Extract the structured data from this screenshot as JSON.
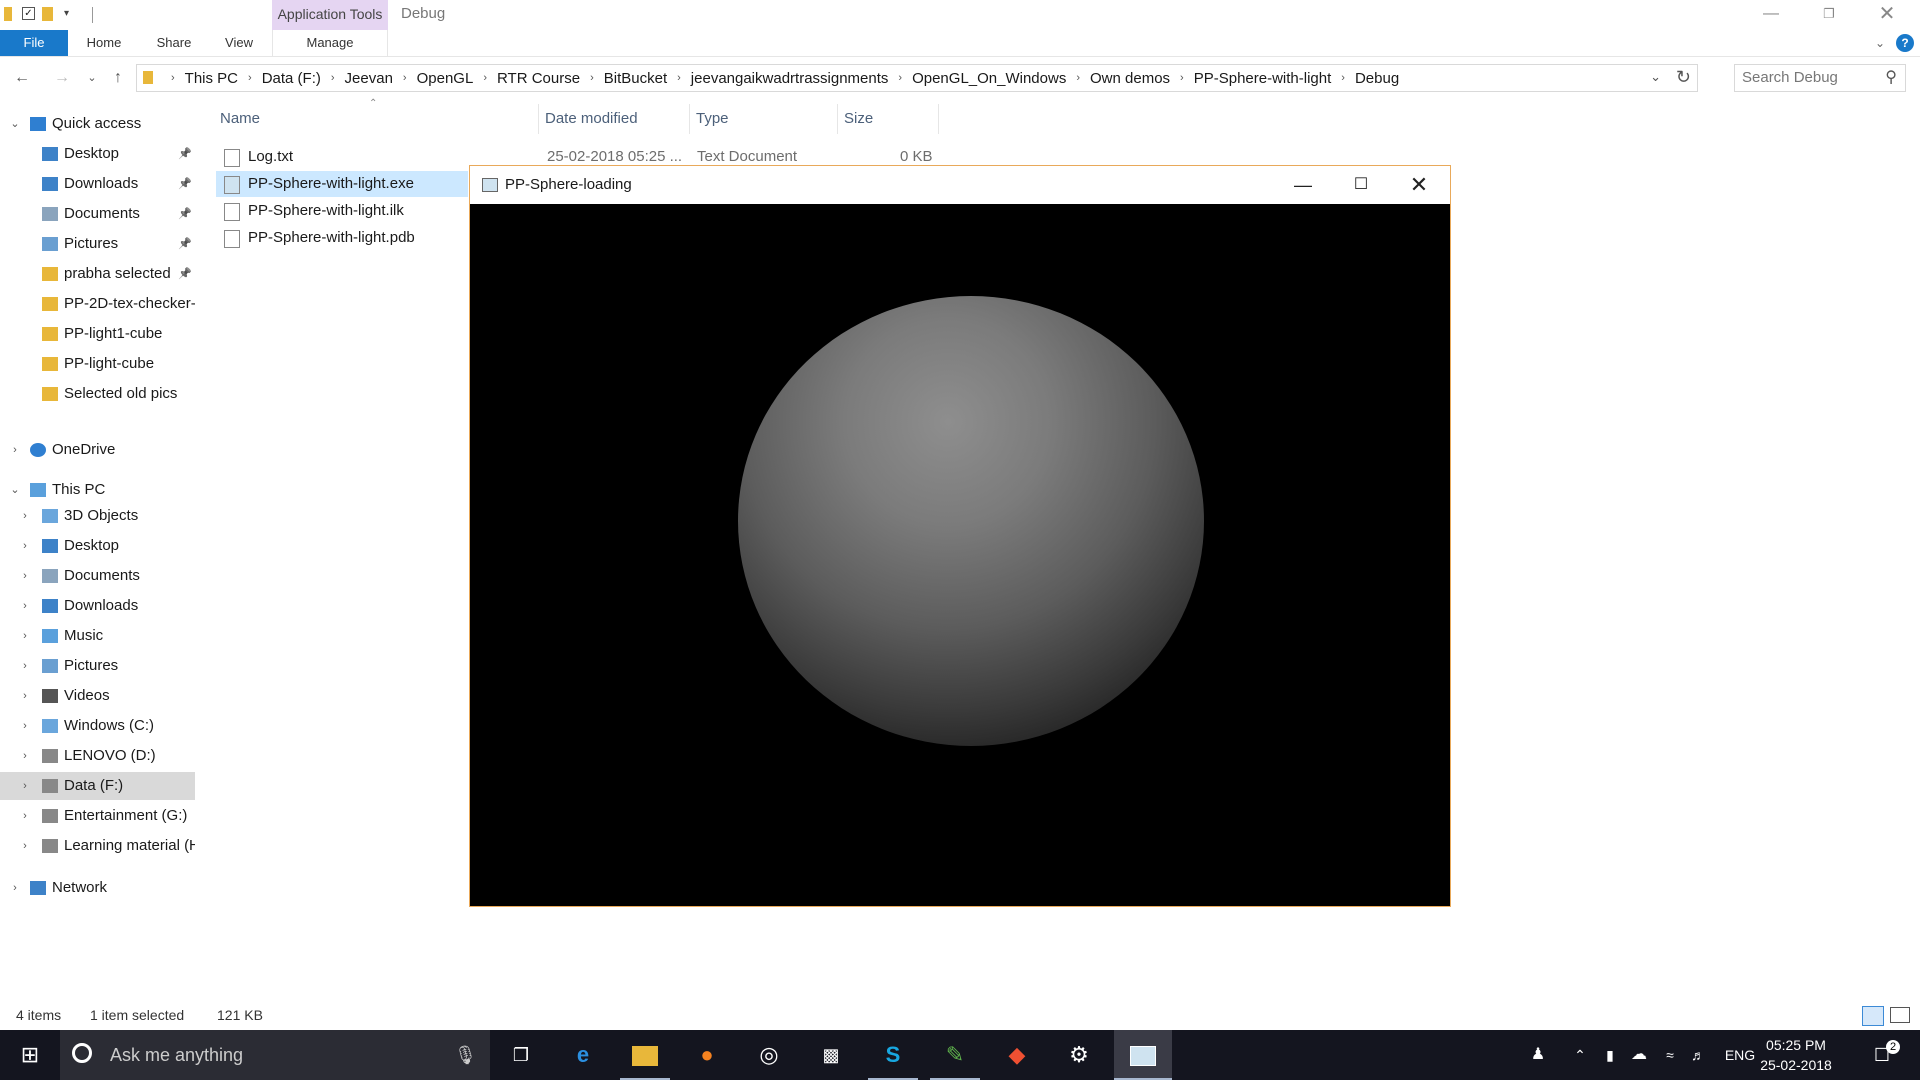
{
  "explorer": {
    "context_tab": "Application Tools",
    "window_title": "Debug",
    "ribbon_tabs": {
      "file": "File",
      "home": "Home",
      "share": "Share",
      "view": "View",
      "manage": "Manage"
    },
    "breadcrumbs": [
      "This PC",
      "Data (F:)",
      "Jeevan",
      "OpenGL",
      "RTR Course",
      "BitBucket",
      "jeevangaikwadrtrassignments",
      "OpenGL_On_Windows",
      "Own demos",
      "PP-Sphere-with-light",
      "Debug"
    ],
    "search_placeholder": "Search Debug",
    "nav": {
      "quick_access": "Quick access",
      "qa_items": [
        "Desktop",
        "Downloads",
        "Documents",
        "Pictures",
        "prabha selected",
        "PP-2D-tex-checker-",
        "PP-light1-cube",
        "PP-light-cube",
        "Selected old pics"
      ],
      "onedrive": "OneDrive",
      "this_pc": "This PC",
      "pc_items": [
        "3D Objects",
        "Desktop",
        "Documents",
        "Downloads",
        "Music",
        "Pictures",
        "Videos",
        "Windows (C:)",
        "LENOVO (D:)",
        "Data (F:)",
        "Entertainment (G:)",
        "Learning material (H"
      ],
      "network": "Network"
    },
    "columns": {
      "name": "Name",
      "date": "Date modified",
      "type": "Type",
      "size": "Size"
    },
    "files": [
      {
        "name": "Log.txt",
        "date": "25-02-2018 05:25 ...",
        "type": "Text Document",
        "size": "0 KB"
      },
      {
        "name": "PP-Sphere-with-light.exe",
        "date": "",
        "type": "",
        "size": ""
      },
      {
        "name": "PP-Sphere-with-light.ilk",
        "date": "",
        "type": "",
        "size": ""
      },
      {
        "name": "PP-Sphere-with-light.pdb",
        "date": "",
        "type": "",
        "size": ""
      }
    ],
    "status": {
      "count": "4 items",
      "selected": "1 item selected",
      "size": "121 KB"
    }
  },
  "gl_window": {
    "title": "PP-Sphere-loading"
  },
  "taskbar": {
    "search_placeholder": "Ask me anything",
    "lang": "ENG",
    "time": "05:25 PM",
    "date": "25-02-2018",
    "notifications": "2"
  },
  "colors": {
    "accent": "#1979ca",
    "context_tab": "#e5d5f2",
    "gl_border": "#e9a95a",
    "taskbar": "#14151f"
  }
}
